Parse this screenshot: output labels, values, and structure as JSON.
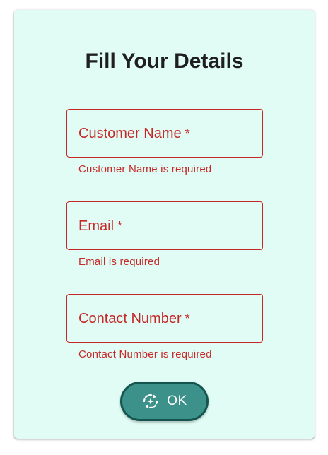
{
  "form": {
    "title": "Fill Your Details",
    "fields": [
      {
        "label": "Customer Name",
        "required_mark": "*",
        "value": "",
        "error": "Customer Name is required"
      },
      {
        "label": "Email",
        "required_mark": "*",
        "value": "",
        "error": "Email is required"
      },
      {
        "label": "Contact Number",
        "required_mark": "*",
        "value": "",
        "error": "Contact Number is required"
      }
    ],
    "submit": {
      "label": "OK",
      "icon": "auto-renew-sparkle-icon"
    }
  },
  "colors": {
    "card_background": "#e0fcf4",
    "error": "#c62828",
    "button_fill": "#3d918b",
    "button_border": "#14564f",
    "title_text": "#1f1f1f"
  }
}
